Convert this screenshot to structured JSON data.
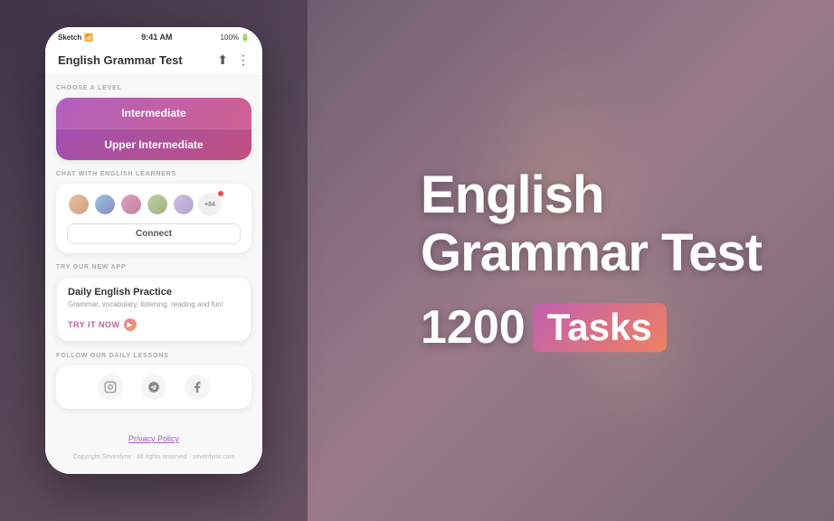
{
  "background": {
    "colors": {
      "main": "#6b5a6e",
      "left_panel": "rgba(60,45,65,0.55)"
    }
  },
  "phone": {
    "status_bar": {
      "carrier": "Sketch",
      "time": "9:41 AM",
      "battery": "100%"
    },
    "header": {
      "title": "English Grammar Test",
      "share_icon": "share",
      "more_icon": "more"
    },
    "choose_level": {
      "label": "CHOOSE A LEVEL",
      "buttons": [
        {
          "text": "Intermediate",
          "active": true
        },
        {
          "text": "Upper Intermediate",
          "active": false
        }
      ]
    },
    "chat_section": {
      "label": "CHAT WITH ENGLISH LEARNERS",
      "plus_count": "+84",
      "connect_btn": "Connect"
    },
    "try_app": {
      "label": "TRY OUR NEW APP",
      "title": "Daily English Practice",
      "description": "Grammar, vocabulary, listening, reading and fun!",
      "cta": "TRY IT NOW"
    },
    "follow": {
      "label": "FOLLOW OUR DAILY LESSONS",
      "platforms": [
        "instagram",
        "telegram",
        "facebook"
      ]
    },
    "footer": {
      "privacy": "Privacy Policy",
      "copyright": "Copyright Sevenlynx · All rights reserved · sevenlynx.com"
    }
  },
  "hero": {
    "title_line1": "English",
    "title_line2": "Grammar Test",
    "number": "1200",
    "tasks_label": "Tasks"
  }
}
